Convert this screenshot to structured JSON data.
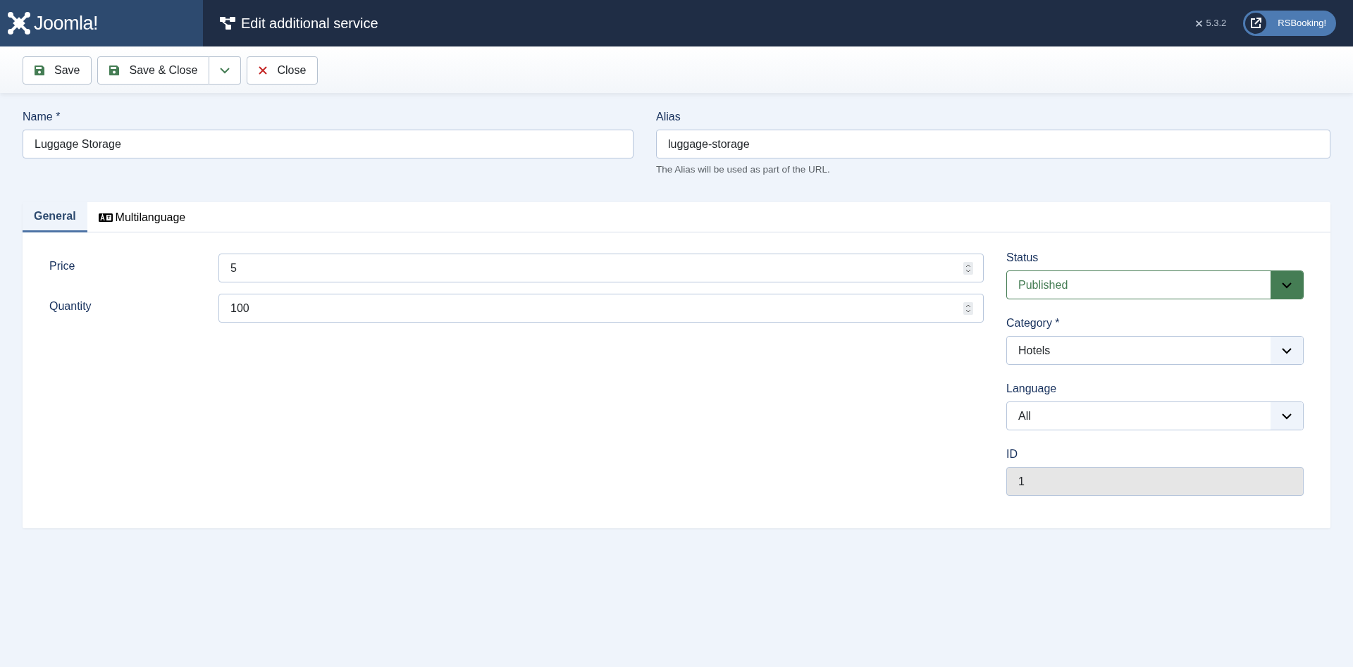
{
  "header": {
    "logo_text": "Joomla!",
    "title": "Edit additional service",
    "version": "5.3.2",
    "site_link": "RSBooking!"
  },
  "toolbar": [
    {
      "label": "Save",
      "kind": "save"
    },
    {
      "label": "Save & Close",
      "kind": "save-dropdown"
    },
    {
      "label": "Close",
      "kind": "close"
    }
  ],
  "name_field": {
    "label": "Name *",
    "value": "Luggage Storage"
  },
  "alias_field": {
    "label": "Alias",
    "value": "luggage-storage",
    "help": "The Alias will be used as part of the URL."
  },
  "tabs": [
    {
      "label": "General",
      "selected": true,
      "kind": "plain"
    },
    {
      "label": "Multilanguage",
      "selected": false,
      "kind": "language"
    }
  ],
  "main_fields": [
    {
      "label": "Price",
      "value": "5"
    },
    {
      "label": "Quantity",
      "value": "100"
    }
  ],
  "side_fields": [
    {
      "label": "Status",
      "value": "Published",
      "kind": "status"
    },
    {
      "label": "Category *",
      "value": "Hotels",
      "kind": "select"
    },
    {
      "label": "Language",
      "value": "All",
      "kind": "select"
    },
    {
      "label": "ID",
      "value": "1",
      "kind": "readonly"
    }
  ]
}
